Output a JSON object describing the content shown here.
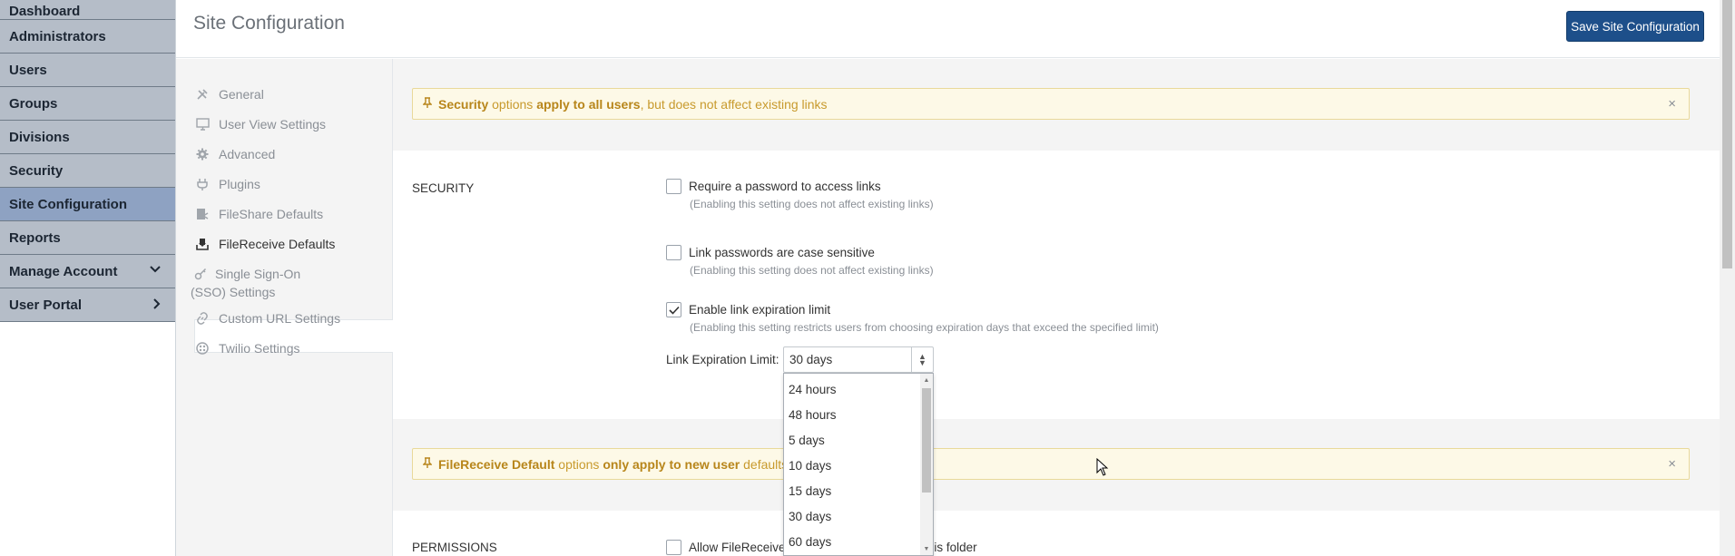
{
  "left_nav": {
    "items": [
      {
        "label": "Dashboard"
      },
      {
        "label": "Administrators"
      },
      {
        "label": "Users"
      },
      {
        "label": "Groups"
      },
      {
        "label": "Divisions"
      },
      {
        "label": "Security"
      },
      {
        "label": "Site Configuration",
        "active": true
      },
      {
        "label": "Reports"
      },
      {
        "label": "Manage Account",
        "chevron": "⌄"
      },
      {
        "label": "User Portal",
        "chevron": "›"
      }
    ]
  },
  "header": {
    "title": "Site Configuration",
    "save_label": "Save Site Configuration"
  },
  "settings_nav": {
    "items": [
      {
        "label": "General",
        "icon": "tools-icon"
      },
      {
        "label": "User View Settings",
        "icon": "monitor-icon"
      },
      {
        "label": "Advanced",
        "icon": "gear-icon"
      },
      {
        "label": "Plugins",
        "icon": "plug-icon"
      },
      {
        "label": "FileShare Defaults",
        "icon": "fileshare-icon"
      },
      {
        "label": "FileReceive Defaults",
        "icon": "filereceive-icon",
        "active": true
      },
      {
        "label": "Single Sign-On (SSO) Settings",
        "icon": "key-icon"
      },
      {
        "label": "Custom URL Settings",
        "icon": "link-icon"
      },
      {
        "label": "Twilio Settings",
        "icon": "twilio-icon"
      }
    ]
  },
  "security_alert": {
    "part1": "Security",
    "part2": " options ",
    "part3": "apply to all users",
    "part4": ", but does not affect existing links",
    "close": "×"
  },
  "security": {
    "section_label": "SECURITY",
    "options": [
      {
        "label": "Require a password to access links",
        "help": "(Enabling this setting does not affect existing links)",
        "checked": false
      },
      {
        "label": "Link passwords are case sensitive",
        "help": "(Enabling this setting does not affect existing links)",
        "checked": false
      },
      {
        "label": "Enable link expiration limit",
        "help": "(Enabling this setting restricts users from choosing expiration days that exceed the specified limit)",
        "checked": true
      }
    ],
    "limit_label": "Link Expiration Limit:",
    "limit_value": "30 days",
    "limit_options": [
      "24 hours",
      "48 hours",
      "5 days",
      "10 days",
      "15 days",
      "30 days",
      "60 days"
    ]
  },
  "filereceive_alert": {
    "part1": "FileReceive Default",
    "part2": " options ",
    "part3": "only apply to new user",
    "part4": " defaults",
    "close": "×"
  },
  "permissions": {
    "section_label": "PERMISSIONS",
    "option_label_start": "Allow FileReceive u",
    "option_label_end": "me name in this folder",
    "checked": false
  },
  "colors": {
    "nav_bg": "#b5bdc8",
    "nav_active": "#8ea2c2",
    "save_button": "#1d4f8a",
    "alert_bg": "#fdf9e7",
    "alert_text": "#c89a2d"
  }
}
